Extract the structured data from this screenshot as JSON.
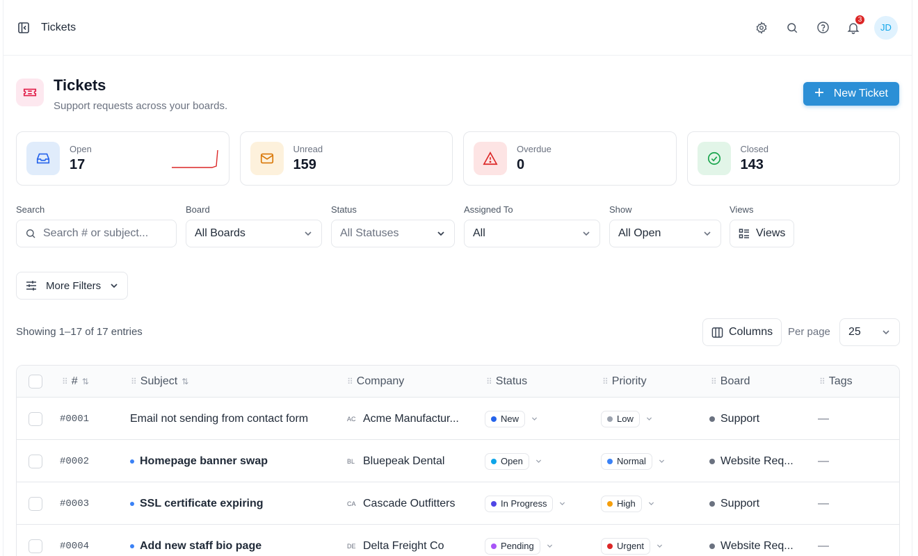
{
  "topbar": {
    "breadcrumb": "Tickets",
    "notification_count": "3",
    "avatar_initials": "JD"
  },
  "header": {
    "title": "Tickets",
    "subtitle": "Support requests across your boards.",
    "new_button_label": "New Ticket"
  },
  "stats": [
    {
      "label": "Open",
      "value": "17",
      "icon": "inbox-icon",
      "color": "#2563eb",
      "bg": "#e0ecfb"
    },
    {
      "label": "Unread",
      "value": "159",
      "icon": "mail-icon",
      "color": "#d97706",
      "bg": "#fdf1dc"
    },
    {
      "label": "Overdue",
      "value": "0",
      "icon": "alert-triangle-icon",
      "color": "#dc2626",
      "bg": "#fde4e4"
    },
    {
      "label": "Closed",
      "value": "143",
      "icon": "check-circle-icon",
      "color": "#16a34a",
      "bg": "#e2f5e8"
    }
  ],
  "filters": {
    "search_label": "Search",
    "search_placeholder": "Search # or subject...",
    "board_label": "Board",
    "board_value": "All Boards",
    "status_label": "Status",
    "status_value": "All Statuses",
    "assigned_label": "Assigned To",
    "assigned_value": "All",
    "show_label": "Show",
    "show_value": "All Open",
    "views_label": "Views",
    "views_button": "Views",
    "more_filters": "More Filters"
  },
  "list": {
    "entries_text": "Showing 1–17 of 17 entries",
    "columns_button": "Columns",
    "per_page_label": "Per page",
    "per_page_value": "25"
  },
  "table": {
    "headers": {
      "id": "#",
      "subject": "Subject",
      "company": "Company",
      "status": "Status",
      "priority": "Priority",
      "board": "Board",
      "tags": "Tags"
    },
    "rows": [
      {
        "id": "#0001",
        "subject": "Email not sending from contact form",
        "unread": false,
        "company_initials": "AC",
        "company": "Acme Manufactur...",
        "status": "New",
        "status_color": "#2563eb",
        "priority": "Low",
        "priority_color": "#9ca3af",
        "board": "Support",
        "tags": "—"
      },
      {
        "id": "#0002",
        "subject": "Homepage banner swap",
        "unread": true,
        "company_initials": "BL",
        "company": "Bluepeak Dental",
        "status": "Open",
        "status_color": "#0ea5e9",
        "priority": "Normal",
        "priority_color": "#3b82f6",
        "board": "Website Req...",
        "tags": "—"
      },
      {
        "id": "#0003",
        "subject": "SSL certificate expiring",
        "unread": true,
        "company_initials": "CA",
        "company": "Cascade Outfitters",
        "status": "In Progress",
        "status_color": "#4f46e5",
        "priority": "High",
        "priority_color": "#f59e0b",
        "board": "Support",
        "tags": "—"
      },
      {
        "id": "#0004",
        "subject": "Add new staff bio page",
        "unread": true,
        "company_initials": "DE",
        "company": "Delta Freight Co",
        "status": "Pending",
        "status_color": "#a855f7",
        "priority": "Urgent",
        "priority_color": "#dc2626",
        "board": "Website Req...",
        "tags": "—"
      }
    ]
  }
}
